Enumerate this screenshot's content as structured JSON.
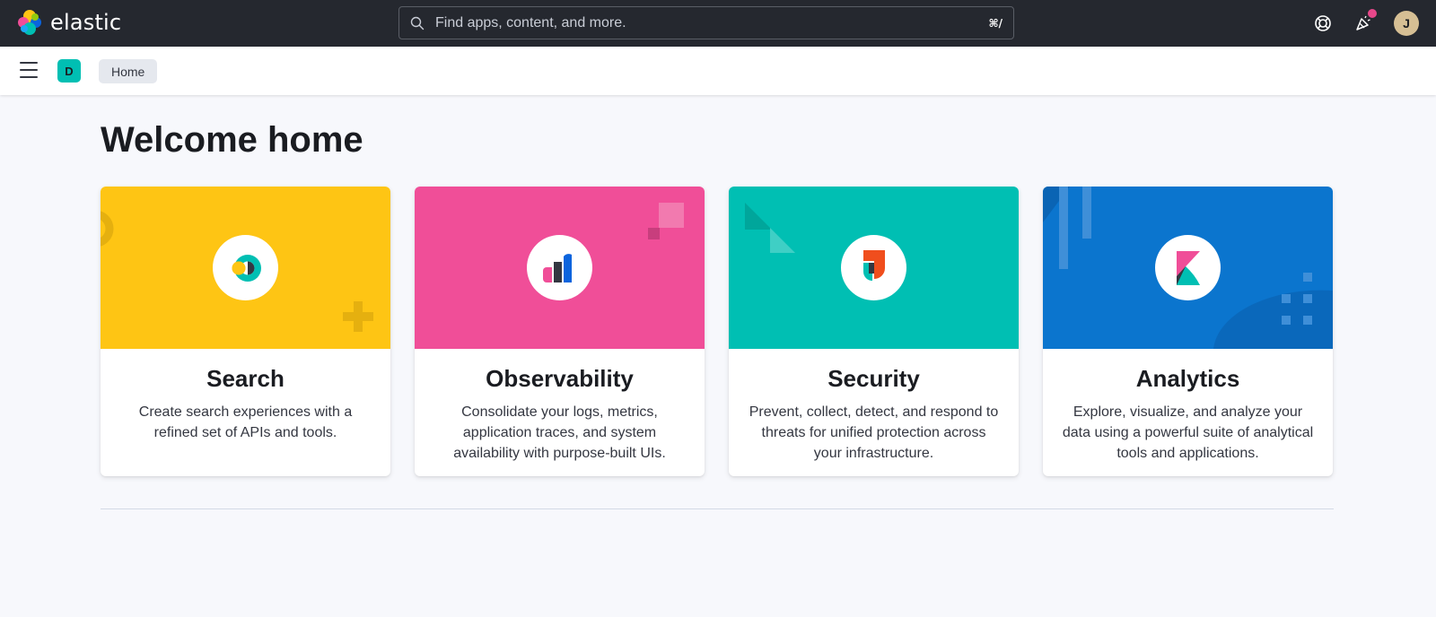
{
  "header": {
    "brand_name": "elastic",
    "search_placeholder": "Find apps, content, and more.",
    "search_shortcut": "⌘/",
    "icons": [
      "help-icon",
      "newsfeed-icon"
    ],
    "avatar_initial": "J"
  },
  "subheader": {
    "space_initial": "D",
    "breadcrumb": "Home"
  },
  "main": {
    "title": "Welcome home",
    "cards": [
      {
        "title": "Search",
        "description": "Create search experiences with a refined set of APIs and tools.",
        "color": "#fec514",
        "icon": "enterprise-search-logo-icon"
      },
      {
        "title": "Observability",
        "description": "Consolidate your logs, metrics, application traces, and system availability with purpose-built UIs.",
        "color": "#f04e98",
        "icon": "observability-logo-icon"
      },
      {
        "title": "Security",
        "description": "Prevent, collect, detect, and respond to threats for unified protection across your infrastructure.",
        "color": "#00bfb3",
        "icon": "security-logo-icon"
      },
      {
        "title": "Analytics",
        "description": "Explore, visualize, and analyze your data using a powerful suite of analytical tools and applications.",
        "color": "#0b75ce",
        "icon": "kibana-logo-icon"
      }
    ]
  }
}
